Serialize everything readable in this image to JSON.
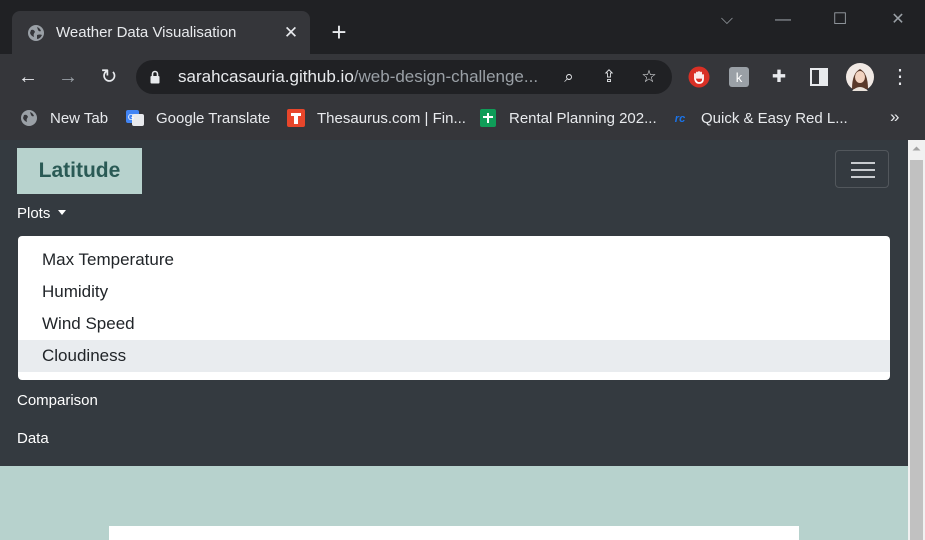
{
  "browser": {
    "tab": {
      "title": "Weather Data Visualisation",
      "close_label": "✕"
    },
    "new_tab_label": "+",
    "window_controls": {
      "tab_search": "⌵",
      "minimize": "—",
      "maximize": "☐",
      "close": "✕"
    },
    "url": {
      "host": "sarahcasauria.github.io",
      "path": "/web-design-challenge..."
    },
    "bookmarks": [
      {
        "label": "New Tab",
        "icon": "globe-icon"
      },
      {
        "label": "Google Translate",
        "icon": "google-translate-icon"
      },
      {
        "label": "Thesaurus.com | Fin...",
        "icon": "thesaurus-icon"
      },
      {
        "label": "Rental Planning 202...",
        "icon": "sheets-icon"
      },
      {
        "label": "Quick & Easy Red L...",
        "icon": "qc-icon"
      }
    ],
    "bookmarks_overflow": "»"
  },
  "page": {
    "brand": "Latitude",
    "nav": {
      "plots_label": "Plots",
      "comparison_label": "Comparison",
      "data_label": "Data"
    },
    "dropdown": {
      "items": [
        {
          "label": "Max Temperature"
        },
        {
          "label": "Humidity"
        },
        {
          "label": "Wind Speed"
        },
        {
          "label": "Cloudiness",
          "active": true
        }
      ]
    }
  },
  "colors": {
    "navbar_bg": "#343a40",
    "brand_bg": "#b7d2cd",
    "brand_text": "#2a5a55",
    "page_bg": "#b7d2cd",
    "dropdown_active": "#e9ecef"
  }
}
